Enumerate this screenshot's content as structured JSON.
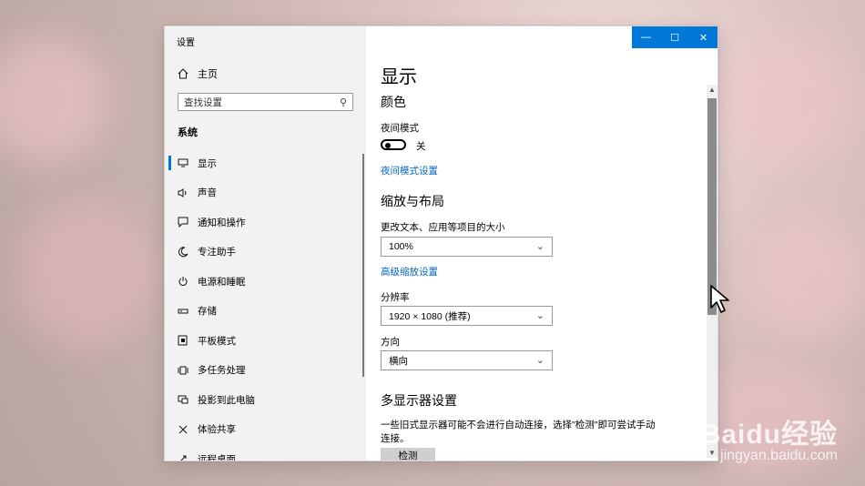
{
  "window": {
    "app_title": "设置",
    "controls": {
      "minimize": "—",
      "maximize": "☐",
      "close": "✕"
    }
  },
  "sidebar": {
    "home_label": "主页",
    "search_placeholder": "查找设置",
    "section_title": "系统",
    "items": [
      {
        "label": "显示",
        "icon": "monitor-icon",
        "active": true
      },
      {
        "label": "声音",
        "icon": "speaker-icon"
      },
      {
        "label": "通知和操作",
        "icon": "message-icon"
      },
      {
        "label": "专注助手",
        "icon": "moon-icon"
      },
      {
        "label": "电源和睡眠",
        "icon": "power-icon"
      },
      {
        "label": "存储",
        "icon": "storage-icon"
      },
      {
        "label": "平板模式",
        "icon": "tablet-icon"
      },
      {
        "label": "多任务处理",
        "icon": "multitask-icon"
      },
      {
        "label": "投影到此电脑",
        "icon": "project-icon"
      },
      {
        "label": "体验共享",
        "icon": "share-icon"
      },
      {
        "label": "远程桌面",
        "icon": "remote-icon"
      }
    ]
  },
  "main": {
    "page_title": "显示",
    "color_heading": "颜色",
    "night_mode_label": "夜间模式",
    "night_mode_state": "关",
    "night_mode_settings_link": "夜间模式设置",
    "scale_heading": "缩放与布局",
    "scale_label": "更改文本、应用等项目的大小",
    "scale_value": "100%",
    "advanced_scale_link": "高级缩放设置",
    "resolution_label": "分辨率",
    "resolution_value": "1920 × 1080 (推荐)",
    "orientation_label": "方向",
    "orientation_value": "横向",
    "multi_display_heading": "多显示器设置",
    "multi_display_desc": "一些旧式显示器可能不会进行自动连接，选择\"检测\"即可尝试手动连接。",
    "detect_button": "检测"
  },
  "watermark": {
    "brand": "Baidu经验",
    "url": "jingyan.baidu.com"
  },
  "colors": {
    "accent": "#0078d7",
    "link": "#0067c0",
    "sidebar_bg": "#f2f2f2"
  }
}
